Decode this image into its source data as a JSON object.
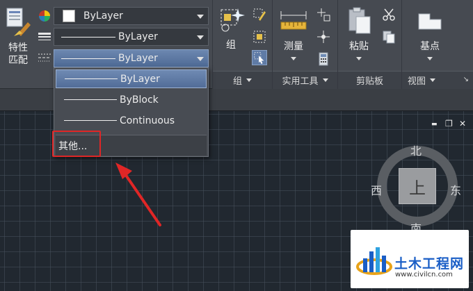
{
  "ribbon": {
    "properties": {
      "match_label_line1": "特性",
      "match_label_line2": "匹配",
      "color_value": "ByLayer",
      "linetype_value": "ByLayer",
      "lineweight_value": "ByLayer"
    },
    "groups": {
      "group_label": "组",
      "footer_label": "组"
    },
    "utilities": {
      "measure_label": "测量",
      "footer_label": "实用工具"
    },
    "clipboard": {
      "paste_label": "粘贴",
      "footer_label": "剪贴板"
    },
    "view": {
      "base_label": "基点",
      "footer_label": "视图",
      "launcher_glyph": "↘"
    }
  },
  "dropdown": {
    "options": [
      "ByLayer",
      "ByBlock",
      "Continuous"
    ],
    "selected_index": 0,
    "other_label": "其他..."
  },
  "viewport_controls": {
    "minimize": "▬",
    "restore": "❐",
    "close": "✕"
  },
  "viewcube": {
    "face_label": "上",
    "north": "北",
    "south": "南",
    "east": "东",
    "west": "西"
  },
  "watermark": {
    "name": "土木工程网",
    "url": "www.civilcn.com"
  },
  "colors": {
    "highlight": "#e02626",
    "selection": "#5f7ba6",
    "ribbon_bg": "#464a51",
    "canvas_bg": "#212830"
  }
}
